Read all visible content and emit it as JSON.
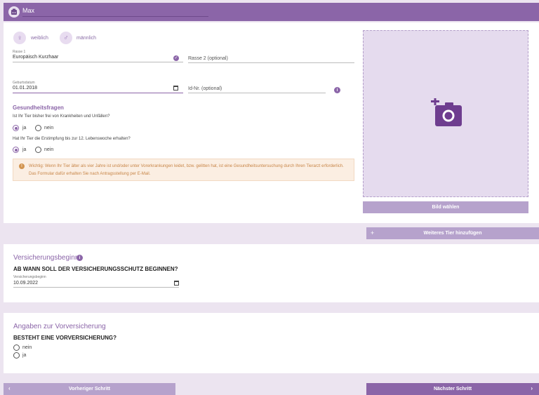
{
  "pet": {
    "name": "Max"
  },
  "gender": {
    "female_label": "weiblich",
    "male_label": "männlich"
  },
  "breed1": {
    "label": "Rasse 1",
    "value": "Europäisch Kurzhaar"
  },
  "breed2": {
    "placeholder": "Rasse 2 (optional)"
  },
  "birthdate": {
    "label": "Geburtsdatum",
    "value": "01.01.2018"
  },
  "id_number": {
    "placeholder": "Id-Nr. (optional)"
  },
  "health": {
    "title": "Gesundheitsfragen",
    "q1": "Ist Ihr Tier bisher frei von Krankheiten und Unfällen?",
    "q2": "Hat Ihr Tier die Erstimpfung bis zur 12. Lebenswoche erhalten?",
    "yes": "ja",
    "no": "nein",
    "q1_selected": "ja",
    "q2_selected": "ja"
  },
  "warning": {
    "text": "Wichtig: Wenn Ihr Tier älter als vier Jahre ist und/oder unter Vorerkrankungen leidet, bzw. gelitten hat, ist eine Gesundheitsuntersuchung durch Ihren Tierarzt erforderlich. Das Formular dafür erhalten Sie nach Antragsstellung per E-Mail."
  },
  "photo": {
    "button_label": "Bild wählen"
  },
  "add_pet": {
    "plus": "+",
    "label": "Weiteres Tier hinzufügen"
  },
  "insurance_start": {
    "title": "Versicherungsbeginn",
    "question": "AB WANN SOLL DER VERSICHERUNGSSCHUTZ BEGINNEN?",
    "field_label": "Versicherungsbeginn",
    "value": "10.09.2022"
  },
  "prior_insurance": {
    "title": "Angaben zur Vorversicherung",
    "question": "BESTEHT EINE VORVERSICHERUNG?",
    "option_no": "nein",
    "option_yes": "ja"
  },
  "nav": {
    "prev_arrow": "‹",
    "prev_label": "Vorheriger Schritt",
    "next_label": "Nächster Schritt",
    "next_arrow": "›"
  },
  "colors": {
    "accent": "#8b65a8",
    "accent_light": "#b6a2cc",
    "background": "#ece4f0",
    "warning_bg": "#fbeee2",
    "warning_text": "#c78547"
  }
}
